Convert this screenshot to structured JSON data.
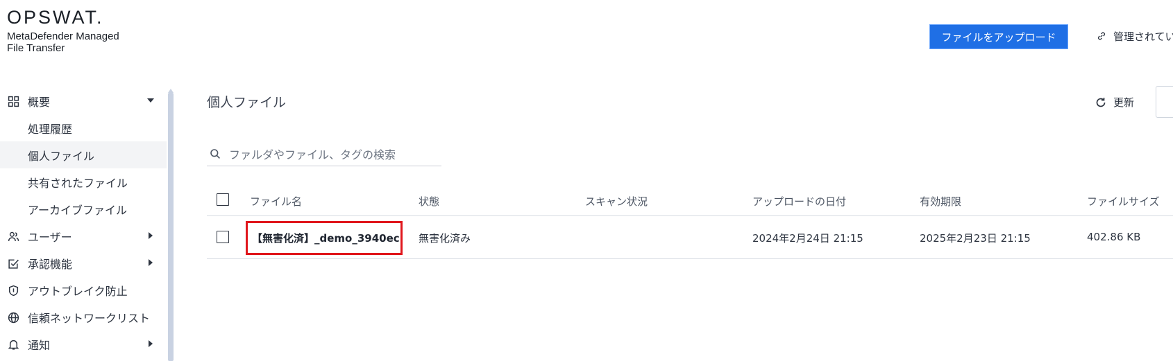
{
  "brand": {
    "logo": "OPSWAT.",
    "product_line1": "MetaDefender Managed",
    "product_line2": "File Transfer"
  },
  "header": {
    "upload_label": "ファイルをアップロード",
    "managed_label": "管理されてい"
  },
  "sidebar": {
    "items": [
      {
        "label": "概要",
        "icon": "grid-icon",
        "caret": "down"
      },
      {
        "label": "処理履歴"
      },
      {
        "label": "個人ファイル",
        "active": true
      },
      {
        "label": "共有されたファイル"
      },
      {
        "label": "アーカイブファイル"
      },
      {
        "label": "ユーザー",
        "icon": "users-icon",
        "caret": "right"
      },
      {
        "label": "承認機能",
        "icon": "approval-icon",
        "caret": "right"
      },
      {
        "label": "アウトブレイク防止",
        "icon": "shield-icon"
      },
      {
        "label": "信頼ネットワークリスト",
        "icon": "globe-icon"
      },
      {
        "label": "通知",
        "icon": "bell-icon",
        "caret": "right"
      }
    ]
  },
  "main": {
    "title": "個人ファイル",
    "refresh_label": "更新",
    "search_placeholder": "ファルダやファイル、タグの検索"
  },
  "table": {
    "columns": [
      "ファイル名",
      "状態",
      "スキャン状況",
      "アップロードの日付",
      "有効期限",
      "ファイルサイズ"
    ],
    "rows": [
      {
        "name": "【無害化済】_demo_3940ec...",
        "state": "無害化済み",
        "scan": "",
        "uploaded": "2024年2月24日 21:15",
        "expires": "2025年2月23日 21:15",
        "size": "402.86 KB"
      }
    ]
  },
  "colors": {
    "accent": "#1f6fe5",
    "highlight": "#e0161c"
  }
}
